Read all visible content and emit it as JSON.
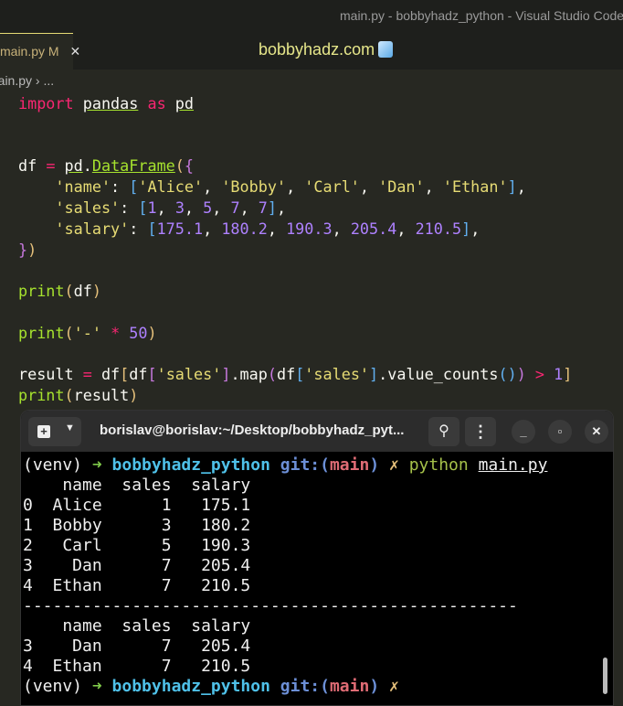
{
  "window_title": "main.py - bobbyhadz_python - Visual Studio Code",
  "tab": {
    "label": "main.py",
    "status": "M",
    "close": "✕"
  },
  "brand": "bobbyhadz.com",
  "breadcrumb": "main.py › ...",
  "code": [
    [
      [
        "import",
        "kw"
      ],
      [
        " ",
        ""
      ],
      [
        "pandas",
        "ul"
      ],
      [
        " ",
        ""
      ],
      [
        "as",
        "kw"
      ],
      [
        " ",
        ""
      ],
      [
        "pd",
        "ul"
      ]
    ],
    [],
    [],
    [
      [
        "df ",
        ""
      ],
      [
        "=",
        "op"
      ],
      [
        " ",
        ""
      ],
      [
        "pd",
        "ul"
      ],
      [
        ".",
        ""
      ],
      [
        "DataFrame",
        "fn ul"
      ],
      [
        "(",
        "y"
      ],
      [
        "{",
        "b1"
      ]
    ],
    [
      [
        "    ",
        ""
      ],
      [
        "'name'",
        "str"
      ],
      [
        ": ",
        ""
      ],
      [
        "[",
        "b2"
      ],
      [
        "'Alice'",
        "str"
      ],
      [
        ", ",
        ""
      ],
      [
        "'Bobby'",
        "str"
      ],
      [
        ", ",
        ""
      ],
      [
        "'Carl'",
        "str"
      ],
      [
        ", ",
        ""
      ],
      [
        "'Dan'",
        "str"
      ],
      [
        ", ",
        ""
      ],
      [
        "'Ethan'",
        "str"
      ],
      [
        "]",
        "b2"
      ],
      [
        ",",
        ""
      ]
    ],
    [
      [
        "    ",
        ""
      ],
      [
        "'sales'",
        "str"
      ],
      [
        ": ",
        ""
      ],
      [
        "[",
        "b2"
      ],
      [
        "1",
        "num"
      ],
      [
        ", ",
        ""
      ],
      [
        "3",
        "num"
      ],
      [
        ", ",
        ""
      ],
      [
        "5",
        "num"
      ],
      [
        ", ",
        ""
      ],
      [
        "7",
        "num"
      ],
      [
        ", ",
        ""
      ],
      [
        "7",
        "num"
      ],
      [
        "]",
        "b2"
      ],
      [
        ",",
        ""
      ]
    ],
    [
      [
        "    ",
        ""
      ],
      [
        "'salary'",
        "str"
      ],
      [
        ": ",
        ""
      ],
      [
        "[",
        "b2"
      ],
      [
        "175.1",
        "num"
      ],
      [
        ", ",
        ""
      ],
      [
        "180.2",
        "num"
      ],
      [
        ", ",
        ""
      ],
      [
        "190.3",
        "num"
      ],
      [
        ", ",
        ""
      ],
      [
        "205.4",
        "num"
      ],
      [
        ", ",
        ""
      ],
      [
        "210.5",
        "num"
      ],
      [
        "]",
        "b2"
      ],
      [
        ",",
        ""
      ]
    ],
    [
      [
        "}",
        "b1"
      ],
      [
        ")",
        "y"
      ]
    ],
    [],
    [
      [
        "print",
        "fn"
      ],
      [
        "(",
        "y"
      ],
      [
        "df",
        ""
      ],
      [
        ")",
        "y"
      ]
    ],
    [],
    [
      [
        "print",
        "fn"
      ],
      [
        "(",
        "y"
      ],
      [
        "'-'",
        "str"
      ],
      [
        " ",
        ""
      ],
      [
        "*",
        "op"
      ],
      [
        " ",
        ""
      ],
      [
        "50",
        "num"
      ],
      [
        ")",
        "y"
      ]
    ],
    [],
    [
      [
        "result ",
        ""
      ],
      [
        "=",
        "op"
      ],
      [
        " df",
        ""
      ],
      [
        "[",
        "y"
      ],
      [
        "df",
        ""
      ],
      [
        "[",
        "b1"
      ],
      [
        "'sales'",
        "str"
      ],
      [
        "]",
        "b1"
      ],
      [
        ".map",
        ""
      ],
      [
        "(",
        "b1"
      ],
      [
        "df",
        ""
      ],
      [
        "[",
        "b2"
      ],
      [
        "'sales'",
        "str"
      ],
      [
        "]",
        "b2"
      ],
      [
        ".value_counts",
        ""
      ],
      [
        "()",
        "b2"
      ],
      [
        ")",
        "b1"
      ],
      [
        " ",
        ""
      ],
      [
        ">",
        "op"
      ],
      [
        " ",
        ""
      ],
      [
        "1",
        "num"
      ],
      [
        "]",
        "y"
      ]
    ],
    [
      [
        "print",
        "fn"
      ],
      [
        "(",
        "y"
      ],
      [
        "result",
        ""
      ],
      [
        ")",
        "y"
      ]
    ]
  ],
  "terminal": {
    "title": "borislav@borislav:~/Desktop/bobbyhadz_pyt...",
    "prompt": {
      "venv": "(venv) ",
      "arrow": "➜",
      "dir": "bobbyhadz_python",
      "git": "git:(",
      "branch": "main",
      "git_close": ")",
      "dirty": "✗",
      "cmd": "python",
      "arg": "main.py"
    },
    "output": [
      "    name  sales  salary",
      "0  Alice      1   175.1",
      "1  Bobby      3   180.2",
      "2   Carl      5   190.3",
      "3    Dan      7   205.4",
      "4  Ethan      7   210.5",
      "--------------------------------------------------",
      "    name  sales  salary",
      "3    Dan      7   205.4",
      "4  Ethan      7   210.5"
    ]
  }
}
